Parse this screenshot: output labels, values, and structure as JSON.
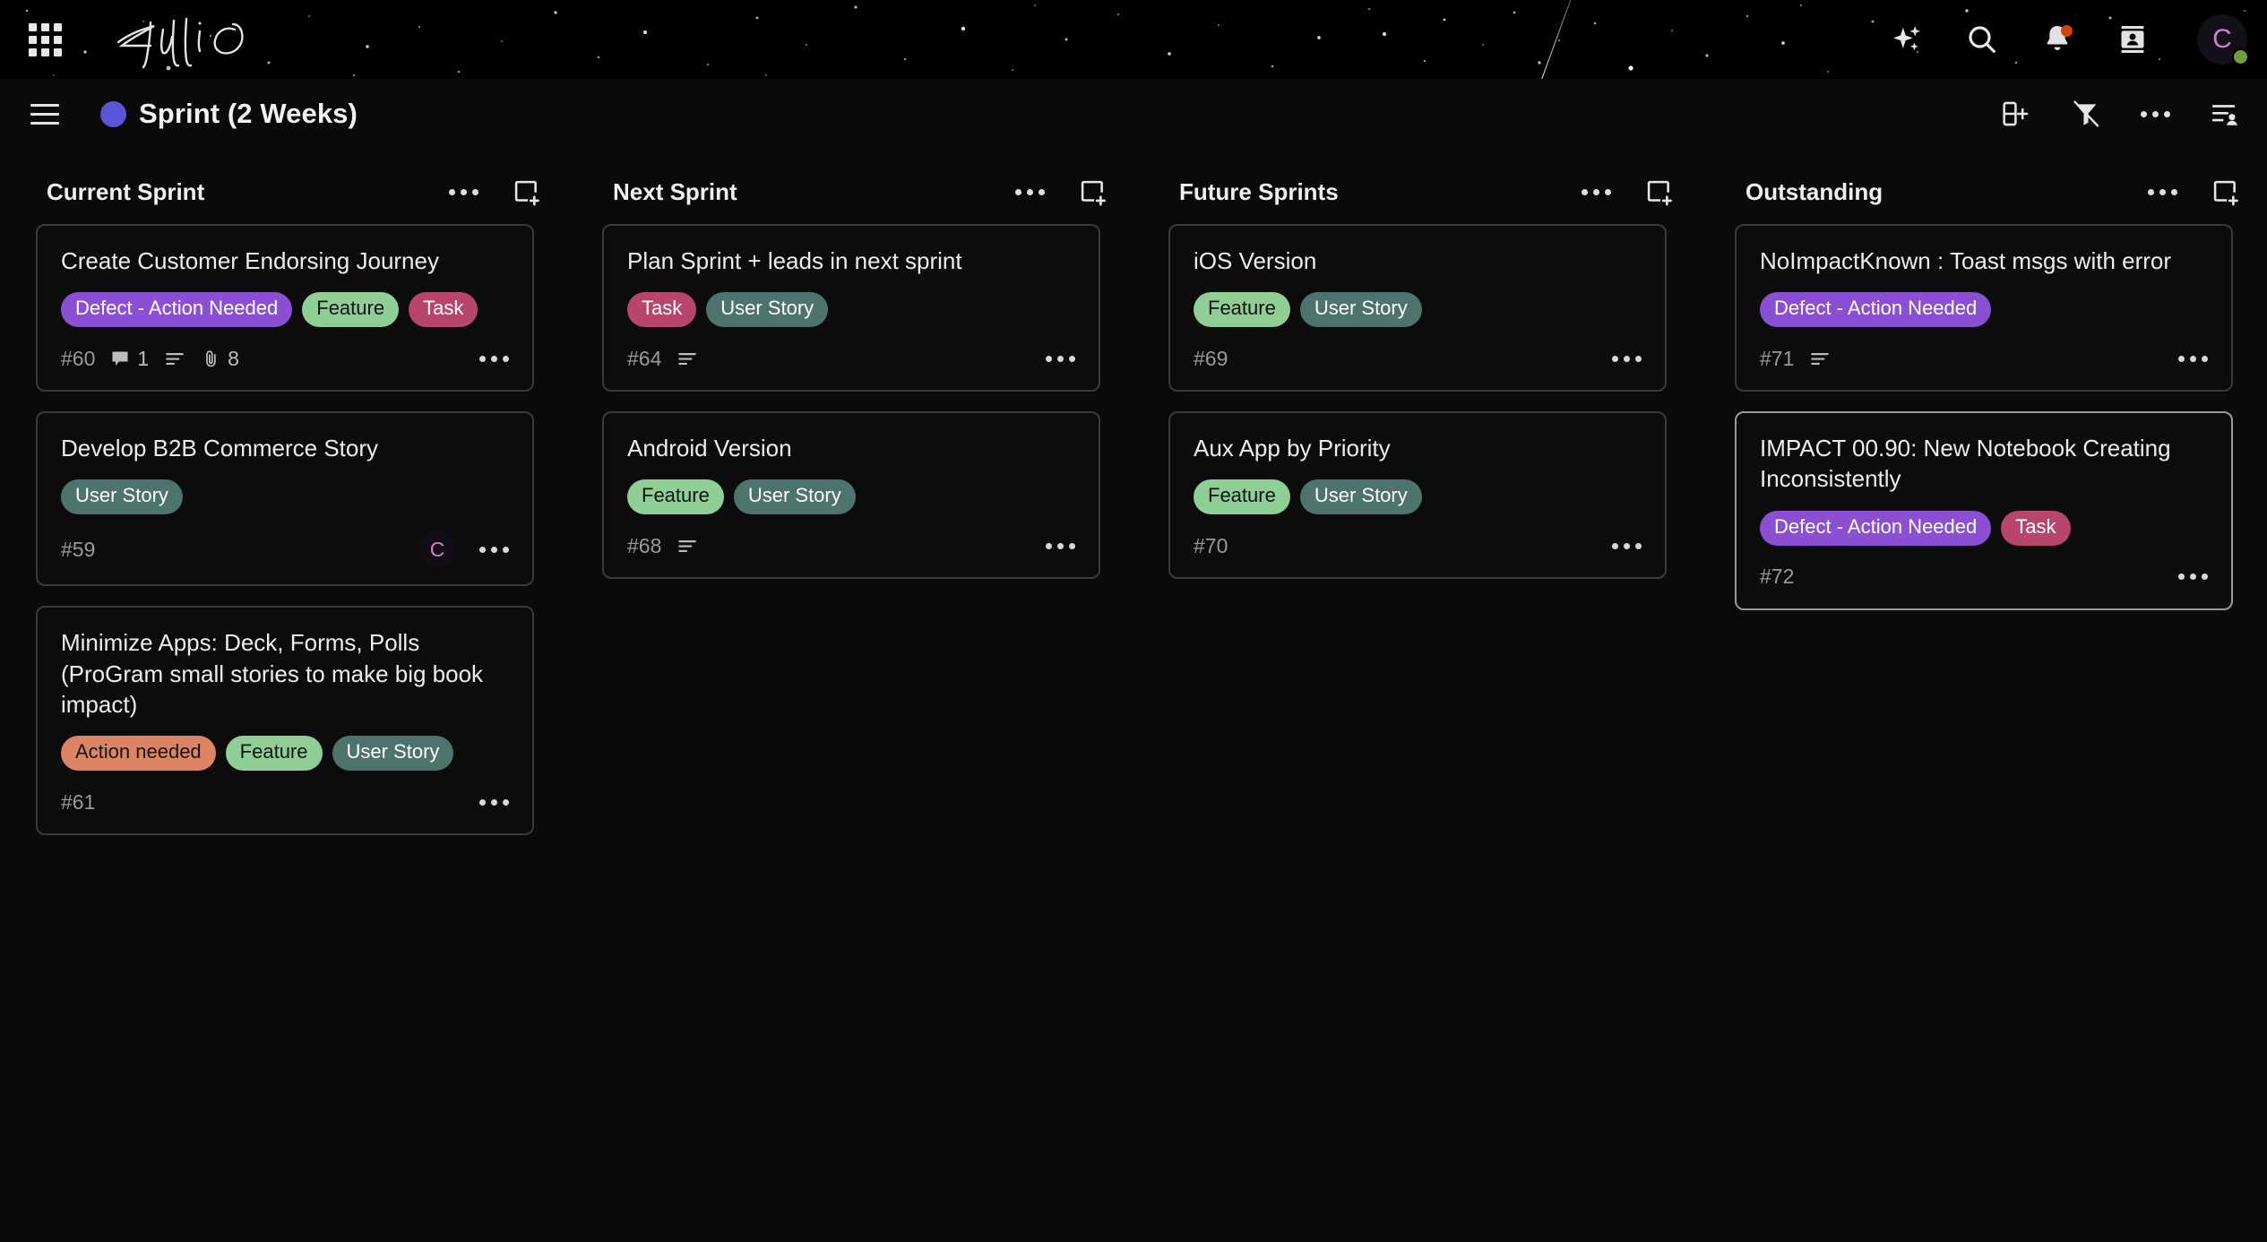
{
  "banner": {
    "apps_grid_icon": "apps-grid-icon",
    "brand_name": "FulliO",
    "actions": [
      {
        "name": "ai-sparkle-icon",
        "label": "AI assistant"
      },
      {
        "name": "search-icon",
        "label": "Search"
      },
      {
        "name": "notifications-bell-icon",
        "label": "Notifications",
        "badge": true
      },
      {
        "name": "contacts-icon",
        "label": "Contacts"
      }
    ],
    "avatar": {
      "initial": "C",
      "status": "online",
      "status_color": "#6f9e3e"
    }
  },
  "subheader": {
    "menu_icon": "hamburger-menu-icon",
    "board_dot_color": "#5a55d6",
    "board_title": "Sprint (2 Weeks)",
    "actions": [
      {
        "name": "add-column-icon",
        "label": "Add column"
      },
      {
        "name": "filter-off-icon",
        "label": "Clear filter"
      },
      {
        "name": "board-more-icon",
        "label": "More options"
      },
      {
        "name": "group-by-assignee-icon",
        "label": "Group by assignee"
      }
    ]
  },
  "board": {
    "columns": [
      {
        "title": "Current Sprint",
        "cards": [
          {
            "title": "Create Customer Endorsing Journey",
            "tags": [
              {
                "label": "Defect - Action Needed",
                "style": "defect"
              },
              {
                "label": "Feature",
                "style": "feature"
              },
              {
                "label": "Task",
                "style": "task"
              }
            ],
            "id": "#60",
            "comments": "1",
            "has_description": true,
            "attachments": "8",
            "assignee": null,
            "highlight": false
          },
          {
            "title": "Develop B2B Commerce Story",
            "tags": [
              {
                "label": "User Story",
                "style": "userstory"
              }
            ],
            "id": "#59",
            "comments": null,
            "has_description": false,
            "attachments": null,
            "assignee": "C",
            "highlight": false
          },
          {
            "title": "Minimize Apps: Deck, Forms, Polls (ProGram small stories to make big book impact)",
            "tags": [
              {
                "label": "Action needed",
                "style": "action"
              },
              {
                "label": "Feature",
                "style": "feature"
              },
              {
                "label": "User Story",
                "style": "userstory"
              }
            ],
            "id": "#61",
            "comments": null,
            "has_description": false,
            "attachments": null,
            "assignee": null,
            "highlight": false
          }
        ]
      },
      {
        "title": "Next Sprint",
        "cards": [
          {
            "title": "Plan Sprint + leads in next sprint",
            "tags": [
              {
                "label": "Task",
                "style": "task"
              },
              {
                "label": "User Story",
                "style": "userstory"
              }
            ],
            "id": "#64",
            "comments": null,
            "has_description": true,
            "attachments": null,
            "assignee": null,
            "highlight": false
          },
          {
            "title": "Android Version",
            "tags": [
              {
                "label": "Feature",
                "style": "feature"
              },
              {
                "label": "User Story",
                "style": "userstory"
              }
            ],
            "id": "#68",
            "comments": null,
            "has_description": true,
            "attachments": null,
            "assignee": null,
            "highlight": false
          }
        ]
      },
      {
        "title": "Future Sprints",
        "cards": [
          {
            "title": "iOS Version",
            "tags": [
              {
                "label": "Feature",
                "style": "feature"
              },
              {
                "label": "User Story",
                "style": "userstory"
              }
            ],
            "id": "#69",
            "comments": null,
            "has_description": false,
            "attachments": null,
            "assignee": null,
            "highlight": false
          },
          {
            "title": "Aux App by Priority",
            "tags": [
              {
                "label": "Feature",
                "style": "feature"
              },
              {
                "label": "User Story",
                "style": "userstory"
              }
            ],
            "id": "#70",
            "comments": null,
            "has_description": false,
            "attachments": null,
            "assignee": null,
            "highlight": false
          }
        ]
      },
      {
        "title": "Outstanding",
        "cards": [
          {
            "title": "NoImpactKnown : Toast msgs with error",
            "tags": [
              {
                "label": "Defect - Action Needed",
                "style": "defect"
              }
            ],
            "id": "#71",
            "comments": null,
            "has_description": true,
            "attachments": null,
            "assignee": null,
            "highlight": false
          },
          {
            "title": "IMPACT 00.90: New Notebook Creating Inconsistently",
            "tags": [
              {
                "label": "Defect - Action Needed",
                "style": "defect"
              },
              {
                "label": "Task",
                "style": "task"
              }
            ],
            "id": "#72",
            "comments": null,
            "has_description": false,
            "attachments": null,
            "assignee": null,
            "highlight": true
          }
        ]
      }
    ]
  }
}
